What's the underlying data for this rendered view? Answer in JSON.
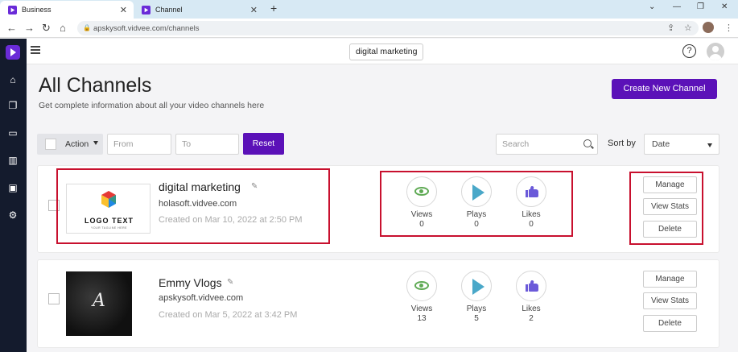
{
  "browser": {
    "tabs": [
      {
        "title": "Business",
        "active": true
      },
      {
        "title": "Channel",
        "active": false
      }
    ],
    "url": "apskysoft.vidvee.com/channels"
  },
  "header": {
    "channel_switch": "digital marketing",
    "help": "?"
  },
  "page": {
    "title": "All Channels",
    "subtitle": "Get complete information about all your video channels here",
    "create_button": "Create New Channel"
  },
  "filters": {
    "action_label": "Action",
    "from_placeholder": "From",
    "to_placeholder": "To",
    "reset_label": "Reset",
    "search_placeholder": "Search",
    "sort_label": "Sort by",
    "sort_value": "Date"
  },
  "channels": [
    {
      "name": "digital marketing",
      "domain": "holasoft.vidvee.com",
      "created": "Created on Mar 10, 2022 at 2:50 PM",
      "logo_text": "LOGO TEXT",
      "logo_tagline": "YOUR TAGLINE HERE",
      "views_label": "Views",
      "views": "0",
      "plays_label": "Plays",
      "plays": "0",
      "likes_label": "Likes",
      "likes": "0",
      "actions": [
        "Manage",
        "View Stats",
        "Delete"
      ]
    },
    {
      "name": "Emmy Vlogs",
      "domain": "apskysoft.vidvee.com",
      "created": "Created on Mar 5, 2022 at 3:42 PM",
      "views_label": "Views",
      "views": "13",
      "plays_label": "Plays",
      "plays": "5",
      "likes_label": "Likes",
      "likes": "2",
      "actions": [
        "Manage",
        "View Stats",
        "Delete"
      ]
    }
  ],
  "colors": {
    "brand": "#5b11b8",
    "sidebar": "#141b2d",
    "highlight": "#c8102e",
    "eye": "#5faa54",
    "play": "#4aa8c9",
    "like": "#6b5ad9"
  }
}
